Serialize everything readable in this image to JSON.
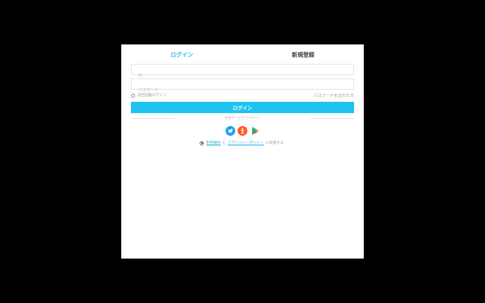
{
  "tabs": {
    "login_label": "ログイン",
    "register_label": "新規登録"
  },
  "form": {
    "id_placeholder": "ID",
    "password_placeholder": "パスワード",
    "auto_login_label": "次回自動ログイン",
    "forgot_password": "パスワードを忘れた方",
    "login_button": "ログイン"
  },
  "divider_text": "外部サービスでログイン",
  "social_icons": [
    "twitter-icon",
    "apple-person-icon",
    "google-play-icon"
  ],
  "terms": {
    "link_terms": "利用規約",
    "and": "と",
    "link_privacy": "プライバシーポリシー",
    "agree": "に同意する"
  },
  "colors": {
    "accent": "#1ec3f0",
    "twitter": "#1da1f2",
    "apple": "#ff5a1f",
    "background": "#000000"
  }
}
